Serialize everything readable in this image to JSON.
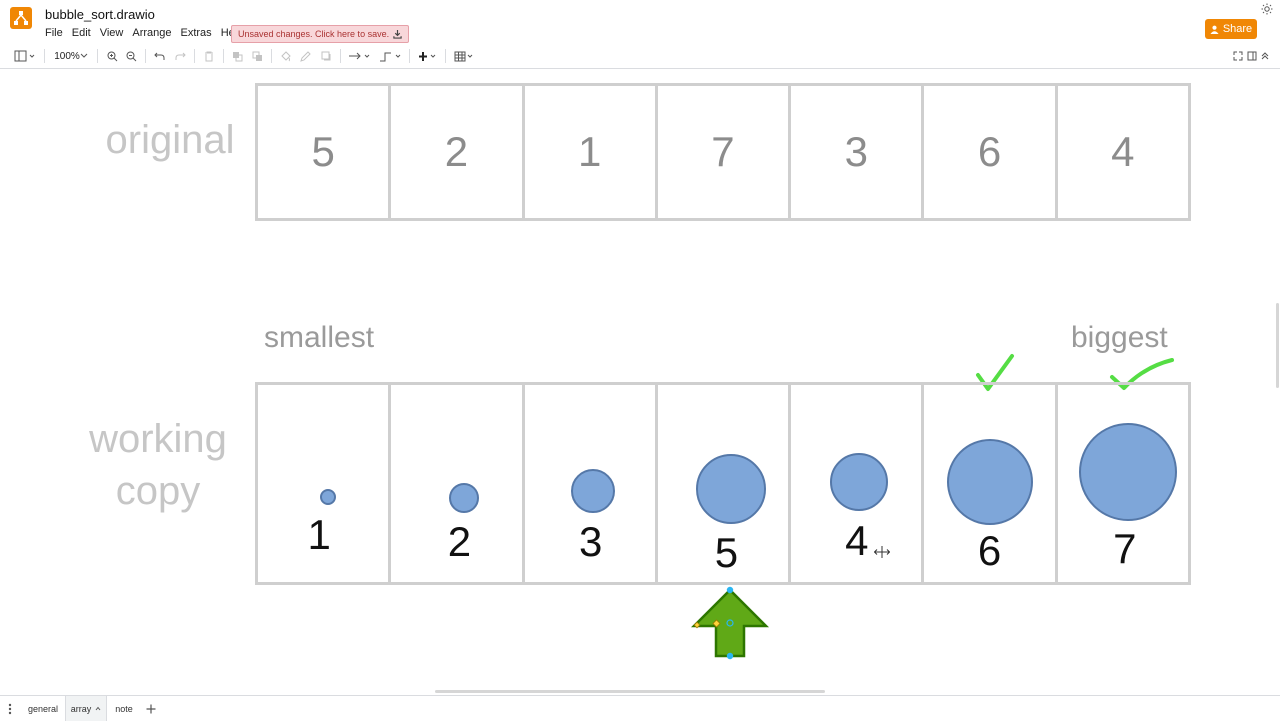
{
  "app": {
    "title": "bubble_sort.drawio",
    "menu": [
      "File",
      "Edit",
      "View",
      "Arrange",
      "Extras",
      "Help"
    ],
    "unsaved_notice": "Unsaved changes. Click here to save.",
    "share_label": "Share"
  },
  "toolbar": {
    "zoom": "100%"
  },
  "canvas": {
    "original_label": "original",
    "working_label_line1": "working",
    "working_label_line2": "copy",
    "smallest_label": "smallest",
    "biggest_label": "biggest",
    "original_values": [
      "5",
      "2",
      "1",
      "7",
      "3",
      "6",
      "4"
    ],
    "working_values": [
      "1",
      "2",
      "3",
      "5",
      "4",
      "6",
      "7"
    ],
    "colors": {
      "bubble_fill": "#7ea6d9",
      "bubble_stroke": "#5578a8",
      "arrow_fill": "#60a917",
      "arrow_stroke": "#2d7600",
      "check": "#55dd44",
      "unsaved_bg": "#f8d7da",
      "brand": "#f08705"
    }
  },
  "pages": [
    "general",
    "array",
    "note"
  ],
  "active_page": "array"
}
